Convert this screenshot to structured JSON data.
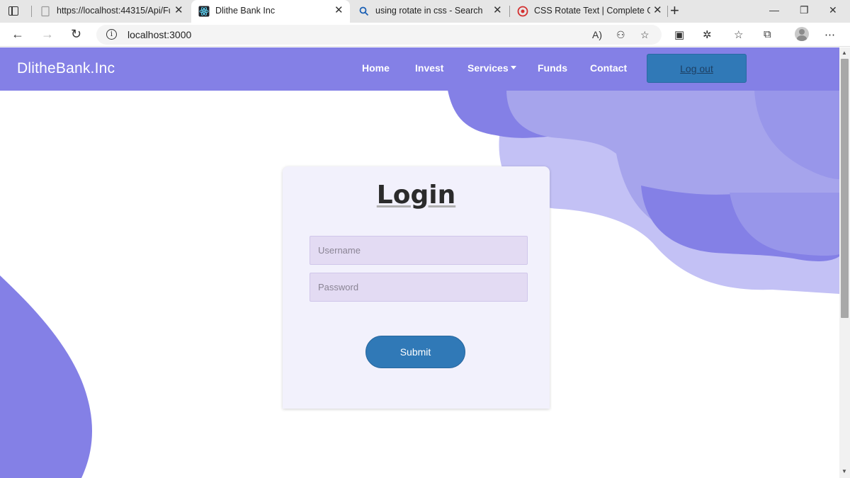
{
  "browser": {
    "tabs": [
      {
        "title": "https://localhost:44315/Api/Func",
        "active": false
      },
      {
        "title": "Dlithe Bank Inc",
        "active": true
      },
      {
        "title": "using rotate in css - Search",
        "active": false
      },
      {
        "title": "CSS Rotate Text | Complete Guid",
        "active": false
      }
    ],
    "address": "localhost:3000"
  },
  "navbar": {
    "brand": "DlitheBank.Inc",
    "links": [
      "Home",
      "Invest",
      "Services",
      "Funds",
      "Contact"
    ],
    "logout_label": "Log out"
  },
  "login": {
    "title": "Login",
    "username_placeholder": "Username",
    "password_placeholder": "Password",
    "submit_label": "Submit"
  },
  "colors": {
    "navbar": "#8480e6",
    "button": "#3079b7",
    "blob_dark": "#8480e6",
    "blob_mid": "#a6a4ec",
    "blob_light": "#c3c1f5",
    "card": "#f2f1fc",
    "input": "#e3dbf3"
  }
}
